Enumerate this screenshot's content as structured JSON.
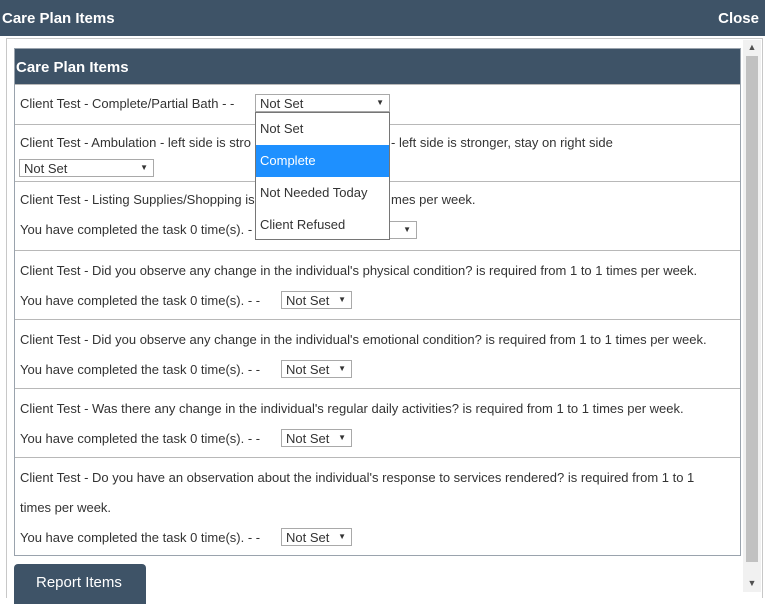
{
  "window": {
    "title": "Care Plan Items",
    "close_label": "Close"
  },
  "panel": {
    "title": "Care Plan Items"
  },
  "items": [
    {
      "text": "Client Test - Complete/Partial Bath - -",
      "select_value": "Not Set",
      "dropdown_open": true,
      "options": [
        "Not Set",
        "Complete",
        "Not Needed Today",
        "Client Refused"
      ],
      "highlighted_option": "Complete"
    },
    {
      "text_left": "Client Test - Ambulation - left side is stro",
      "text_right": "-   left side is stronger, stay on right side",
      "select_value": "Not Set"
    },
    {
      "text_left": "Client Test - Listing Supplies/Shopping is",
      "text_right": "mes per week.",
      "completed_left": "You have completed the task 0 time(s). -"
    },
    {
      "text": "Client Test - Did you observe any change in the individual's physical condition? is required from 1 to 1 times per week.",
      "completed": "You have completed the task 0 time(s). - -",
      "select_value": "Not Set"
    },
    {
      "text": "Client Test - Did you observe any change in the individual's emotional condition? is required from 1 to 1 times per week.",
      "completed": "You have completed the task 0 time(s). - -",
      "select_value": "Not Set"
    },
    {
      "text": "Client Test - Was there any change in the individual's regular daily activities? is required from 1 to 1 times per week.",
      "completed": "You have completed the task 0 time(s). - -",
      "select_value": "Not Set"
    },
    {
      "text_line1": "Client Test - Do you have an observation about the individual's response to services rendered? is required from 1 to 1",
      "text_line2": "times per week.",
      "completed": "You have completed the task 0 time(s). - -",
      "select_value": "Not Set"
    }
  ],
  "footer": {
    "report_button": "Report Items"
  },
  "colors": {
    "header": "#3e5367",
    "highlight": "#1e90ff"
  }
}
